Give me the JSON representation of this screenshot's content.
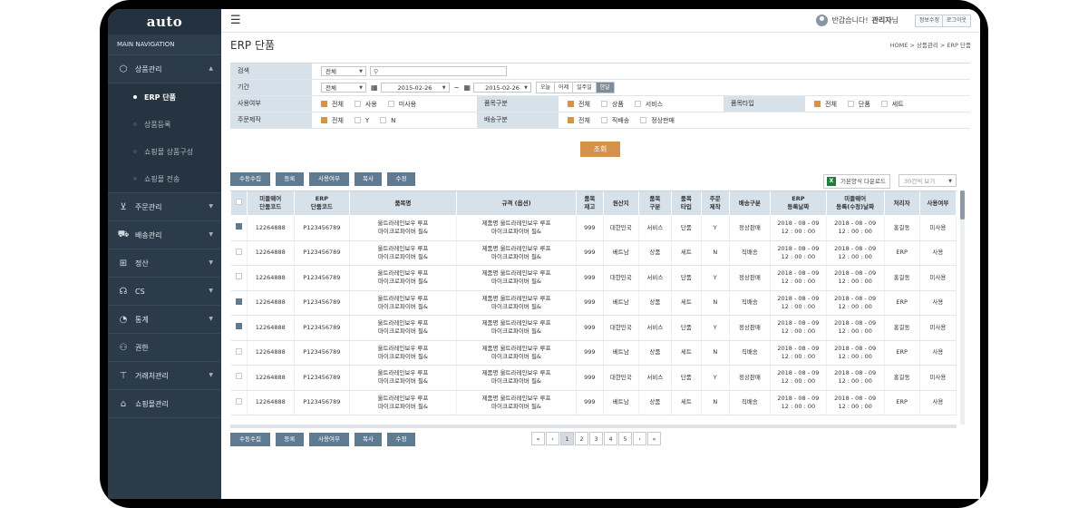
{
  "app": {
    "logo": "auto"
  },
  "sidebar": {
    "title": "MAIN NAVIGATION",
    "items": [
      {
        "label": "상품관리",
        "icon": "cube-icon",
        "open": true,
        "sub": [
          {
            "label": "ERP 단품",
            "active": true
          },
          {
            "label": "상품등록"
          },
          {
            "label": "쇼핑몰 상품구성"
          },
          {
            "label": "쇼핑몰 전송"
          }
        ]
      },
      {
        "label": "주문관리",
        "icon": "cart-icon",
        "chev": true
      },
      {
        "label": "배송관리",
        "icon": "truck-icon",
        "chev": true
      },
      {
        "label": "정산",
        "icon": "calc-icon",
        "chev": true
      },
      {
        "label": "CS",
        "icon": "headset-icon",
        "chev": true
      },
      {
        "label": "통계",
        "icon": "pie-chart-icon",
        "chev": true
      },
      {
        "label": "권한",
        "icon": "user-lock-icon"
      },
      {
        "label": "거래처관리",
        "icon": "org-chart-icon",
        "chev": true
      },
      {
        "label": "쇼핑몰관리",
        "icon": "store-icon"
      }
    ]
  },
  "header": {
    "welcome_prefix": "반갑습니다!",
    "user_name": "관리자",
    "user_suffix": "님",
    "edit_info": "정보수정",
    "logout": "로그아웃"
  },
  "page": {
    "title": "ERP 단품",
    "breadcrumb": "HOME  >  상품관리  >  ERP 단품"
  },
  "filters": {
    "search_label": "검색",
    "search_select": "전체",
    "search_placeholder": "",
    "period_label": "기간",
    "period_select": "전체",
    "date_from": "2015-02-26",
    "date_sep": "~",
    "date_to": "2015-02-26",
    "quick": [
      "오늘",
      "어제",
      "일주일",
      "한달"
    ],
    "use_label": "사용여부",
    "use_opts": [
      "전체",
      "사용",
      "미사용"
    ],
    "itemcat_label": "품목구분",
    "itemcat_opts": [
      "전체",
      "상품",
      "서비스"
    ],
    "itemtype_label": "품목타입",
    "itemtype_opts": [
      "전체",
      "단품",
      "세트"
    ],
    "order_label": "주문제작",
    "order_opts": [
      "전체",
      "Y",
      "N"
    ],
    "ship_label": "배송구분",
    "ship_opts": [
      "전체",
      "직배송",
      "정상판매"
    ],
    "search_button": "조회"
  },
  "actions": {
    "manual": "수동수집",
    "register": "등록",
    "use": "사용여부",
    "copy": "복사",
    "edit": "수정",
    "excel": "기본양식 다운로드",
    "page_size": "30건씩 보기"
  },
  "table": {
    "headers": [
      "",
      "미들웨어\n단품코드",
      "ERP\n단품코드",
      "품목명",
      "규격 (옵션)",
      "품목\n재고",
      "원산지",
      "품목\n구분",
      "품목\n타입",
      "주문\n제작",
      "배송구분",
      "ERP\n등록날짜",
      "미들웨어\n등록(수정)날짜",
      "처리자",
      "사용여부"
    ],
    "rows": [
      {
        "checked": true,
        "mw": "12264888",
        "erp": "P123456789",
        "name": "울트라레인보우 루프\n마이크로파이버 필&",
        "spec": "제품명 울트라레인보우 루프\n마이크로파이버 필&",
        "stock": "999",
        "origin": "대한민국",
        "cat": "서비스",
        "type": "단품",
        "custom": "Y",
        "ship": "정상판매",
        "erpdate": "2018 - 08 - 09\n12 : 00 : 00",
        "mwdate": "2018 - 08 - 09\n12 : 00 : 00",
        "handler": "홍길동",
        "use": "미사용"
      },
      {
        "checked": false,
        "mw": "12264888",
        "erp": "P123456789",
        "name": "울트라레인보우 루프\n마이크로파이버 필&",
        "spec": "제품명 울트라레인보우 루프\n마이크로파이버 필&",
        "stock": "999",
        "origin": "베트남",
        "cat": "상품",
        "type": "세트",
        "custom": "N",
        "ship": "직배송",
        "erpdate": "2018 - 08 - 09\n12 : 00 : 00",
        "mwdate": "2018 - 08 - 09\n12 : 00 : 00",
        "handler": "ERP",
        "use": "사용"
      },
      {
        "checked": false,
        "mw": "12264888",
        "erp": "P123456789",
        "name": "울트라레인보우 루프\n마이크로파이버 필&",
        "spec": "제품명 울트라레인보우 루프\n마이크로파이버 필&",
        "stock": "999",
        "origin": "대한민국",
        "cat": "서비스",
        "type": "단품",
        "custom": "Y",
        "ship": "정상판매",
        "erpdate": "2018 - 08 - 09\n12 : 00 : 00",
        "mwdate": "2018 - 08 - 09\n12 : 00 : 00",
        "handler": "홍길동",
        "use": "미사용"
      },
      {
        "checked": true,
        "mw": "12264888",
        "erp": "P123456789",
        "name": "울트라레인보우 루프\n마이크로파이버 필&",
        "spec": "제품명 울트라레인보우 루프\n마이크로파이버 필&",
        "stock": "999",
        "origin": "베트남",
        "cat": "상품",
        "type": "세트",
        "custom": "N",
        "ship": "직배송",
        "erpdate": "2018 - 08 - 09\n12 : 00 : 00",
        "mwdate": "2018 - 08 - 09\n12 : 00 : 00",
        "handler": "ERP",
        "use": "사용"
      },
      {
        "checked": true,
        "mw": "12264888",
        "erp": "P123456789",
        "name": "울트라레인보우 루프\n마이크로파이버 필&",
        "spec": "제품명 울트라레인보우 루프\n마이크로파이버 필&",
        "stock": "999",
        "origin": "대한민국",
        "cat": "서비스",
        "type": "단품",
        "custom": "Y",
        "ship": "정상판매",
        "erpdate": "2018 - 08 - 09\n12 : 00 : 00",
        "mwdate": "2018 - 08 - 09\n12 : 00 : 00",
        "handler": "홍길동",
        "use": "미사용"
      },
      {
        "checked": false,
        "mw": "12264888",
        "erp": "P123456789",
        "name": "울트라레인보우 루프\n마이크로파이버 필&",
        "spec": "제품명 울트라레인보우 루프\n마이크로파이버 필&",
        "stock": "999",
        "origin": "베트남",
        "cat": "상품",
        "type": "세트",
        "custom": "N",
        "ship": "직배송",
        "erpdate": "2018 - 08 - 09\n12 : 00 : 00",
        "mwdate": "2018 - 08 - 09\n12 : 00 : 00",
        "handler": "ERP",
        "use": "사용"
      },
      {
        "checked": false,
        "mw": "12264888",
        "erp": "P123456789",
        "name": "울트라레인보우 루프\n마이크로파이버 필&",
        "spec": "제품명 울트라레인보우 루프\n마이크로파이버 필&",
        "stock": "999",
        "origin": "대한민국",
        "cat": "서비스",
        "type": "단품",
        "custom": "Y",
        "ship": "정상판매",
        "erpdate": "2018 - 08 - 09\n12 : 00 : 00",
        "mwdate": "2018 - 08 - 09\n12 : 00 : 00",
        "handler": "홍길동",
        "use": "미사용"
      },
      {
        "checked": false,
        "mw": "12264888",
        "erp": "P123456789",
        "name": "울트라레인보우 루프\n마이크로파이버 필&",
        "spec": "제품명 울트라레인보우 루프\n마이크로파이버 필&",
        "stock": "999",
        "origin": "베트남",
        "cat": "상품",
        "type": "세트",
        "custom": "N",
        "ship": "직배송",
        "erpdate": "2018 - 08 - 09\n12 : 00 : 00",
        "mwdate": "2018 - 08 - 09\n12 : 00 : 00",
        "handler": "ERP",
        "use": "사용"
      }
    ]
  },
  "pager": {
    "first": "«",
    "prev": "‹",
    "pages": [
      "1",
      "2",
      "3",
      "4",
      "5"
    ],
    "current": "1",
    "next": "›",
    "last": "»"
  },
  "colors": {
    "sidebar": "#2c3b49",
    "accent": "#d4924a",
    "button": "#5f7a91",
    "label_bg": "#d7e1ea"
  }
}
